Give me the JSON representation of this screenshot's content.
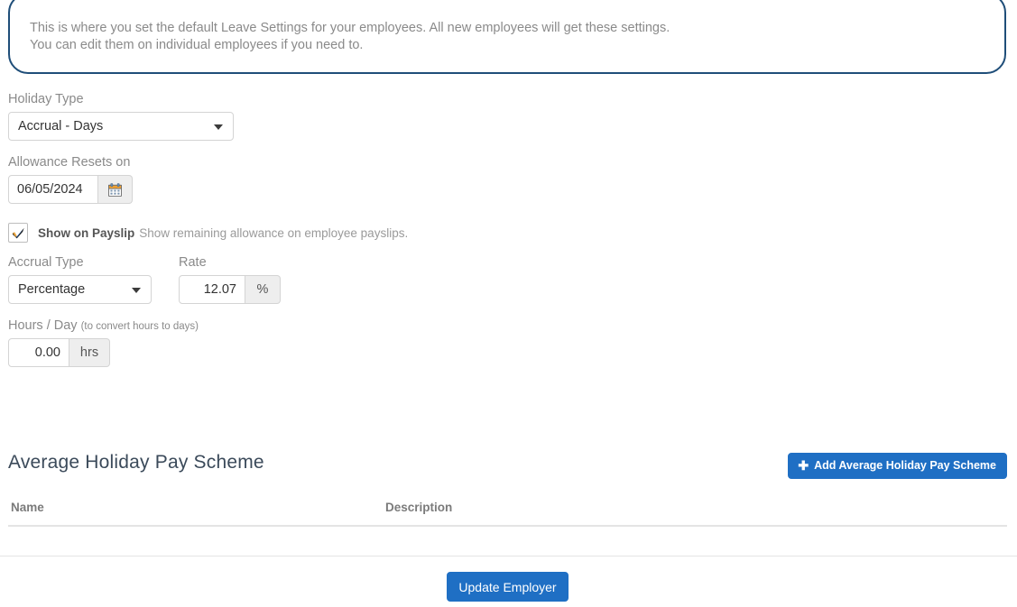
{
  "info": {
    "message": "This is where you set the default Leave Settings for your employees. All new employees will get these settings.\nYou can edit them on individual employees if you need to.",
    "border_color": "#1f4e79"
  },
  "form": {
    "holiday_type": {
      "label": "Holiday Type",
      "value": "Accrual - Days",
      "icon": "chevron-down-icon"
    },
    "allowance_resets_on": {
      "label": "Allowance Resets on",
      "value": "06/05/2024",
      "icon": "calendar-icon"
    },
    "show_on_payslip": {
      "checked": true,
      "label": "Show on Payslip",
      "help": "Show remaining allowance on employee payslips.",
      "icon": "check-icon"
    },
    "accrual_type": {
      "label": "Accrual Type",
      "value": "Percentage",
      "icon": "chevron-down-icon"
    },
    "rate": {
      "label": "Rate",
      "value": "12.07",
      "unit": "%"
    },
    "hours_per_day": {
      "label": "Hours / Day",
      "hint": "(to convert hours to days)",
      "value": "0.00",
      "unit": "hrs"
    }
  },
  "scheme_section": {
    "title": "Average Holiday Pay Scheme",
    "add_button": {
      "label": "Add Average Holiday Pay Scheme",
      "icon": "plus-icon",
      "color": "#1f6fc4"
    },
    "table": {
      "columns": [
        "Name",
        "Description"
      ],
      "rows": []
    }
  },
  "footer": {
    "update_button": {
      "label": "Update Employer",
      "color": "#1f6fc4"
    }
  }
}
